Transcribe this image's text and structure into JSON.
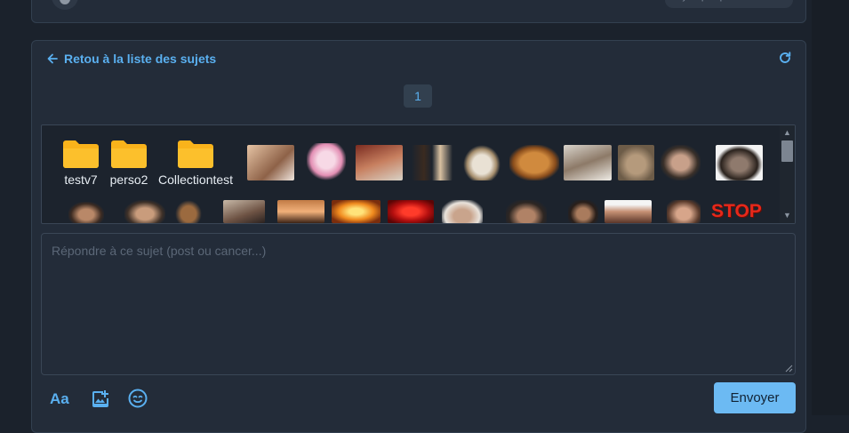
{
  "top_card": {
    "time_label": "il y a quelques secondes"
  },
  "topic": {
    "back_label": "Retou à la liste des sujets",
    "page_number": "1"
  },
  "sticker_panel": {
    "folders": [
      {
        "label": "testv7"
      },
      {
        "label": "perso2"
      },
      {
        "label": "Collectiontest"
      }
    ],
    "last_sticker_text": "STOP"
  },
  "reply": {
    "placeholder": "Répondre à ce sujet (post ou cancer...)",
    "value": ""
  },
  "toolbar": {
    "format_label": "Aa",
    "send_label": "Envoyer"
  },
  "colors": {
    "accent": "#5ab0f0",
    "send_button": "#6cbaf3",
    "folder": "#f9b31b",
    "card_bg": "#232c39",
    "page_bg": "#1b222c"
  }
}
